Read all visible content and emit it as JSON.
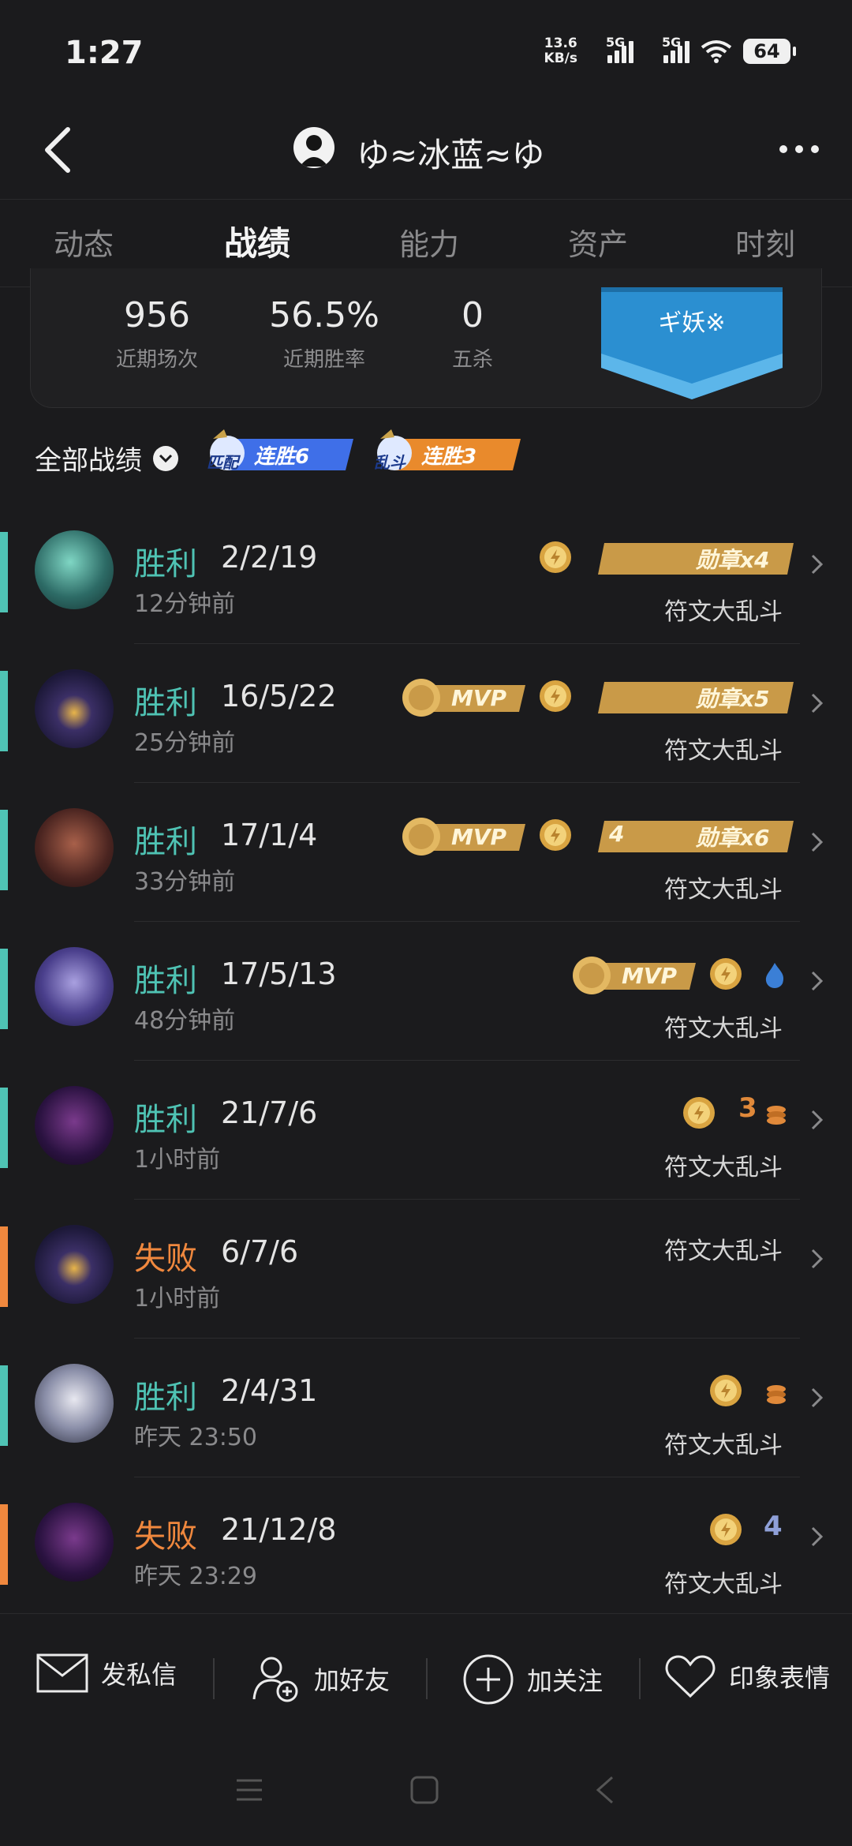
{
  "status": {
    "time": "1:27",
    "speed_value": "13.6",
    "speed_unit": "KB/s",
    "net1": "5G",
    "net2": "5G",
    "battery": "64"
  },
  "header": {
    "title": "ゆ≈冰蓝≈ゆ"
  },
  "tabs": [
    {
      "label": "动态"
    },
    {
      "label": "战绩"
    },
    {
      "label": "能力"
    },
    {
      "label": "资产"
    },
    {
      "label": "时刻"
    }
  ],
  "summary": {
    "stats": [
      {
        "value": "956",
        "label": "近期场次"
      },
      {
        "value": "56.5%",
        "label": "近期胜率"
      },
      {
        "value": "0",
        "label": "五杀"
      }
    ],
    "banner": "ギ妖※"
  },
  "filter": {
    "label": "全部战绩",
    "streaks": [
      {
        "tag": "匹配",
        "text": "连胜6"
      },
      {
        "tag": "乱斗",
        "text": "连胜3"
      }
    ]
  },
  "matches": [
    {
      "result": "胜利",
      "kda": "2/2/19",
      "time": "12分钟前",
      "mode": "符文大乱斗",
      "medal": "勋章x4"
    },
    {
      "result": "胜利",
      "kda": "16/5/22",
      "time": "25分钟前",
      "mode": "符文大乱斗",
      "mvp": "MVP",
      "medal": "勋章x5"
    },
    {
      "result": "胜利",
      "kda": "17/1/4",
      "time": "33分钟前",
      "mode": "符文大乱斗",
      "mvp": "MVP",
      "medal": "勋章x6",
      "medal_prefix": "4"
    },
    {
      "result": "胜利",
      "kda": "17/5/13",
      "time": "48分钟前",
      "mode": "符文大乱斗",
      "mvp": "MVP"
    },
    {
      "result": "胜利",
      "kda": "21/7/6",
      "time": "1小时前",
      "mode": "符文大乱斗",
      "mini": "3"
    },
    {
      "result": "失败",
      "kda": "6/7/6",
      "time": "1小时前",
      "mode": "符文大乱斗"
    },
    {
      "result": "胜利",
      "kda": "2/4/31",
      "time": "昨天 23:50",
      "mode": "符文大乱斗"
    },
    {
      "result": "失败",
      "kda": "21/12/8",
      "time": "昨天 23:29",
      "mode": "符文大乱斗",
      "mini": "4"
    }
  ],
  "actions": [
    {
      "label": "发私信"
    },
    {
      "label": "加好友"
    },
    {
      "label": "加关注"
    },
    {
      "label": "印象表情"
    }
  ],
  "colors": {
    "win": "#4fc3b4",
    "lose": "#f0883e",
    "gold": "#d9a441",
    "background": "#1b1b1d"
  }
}
